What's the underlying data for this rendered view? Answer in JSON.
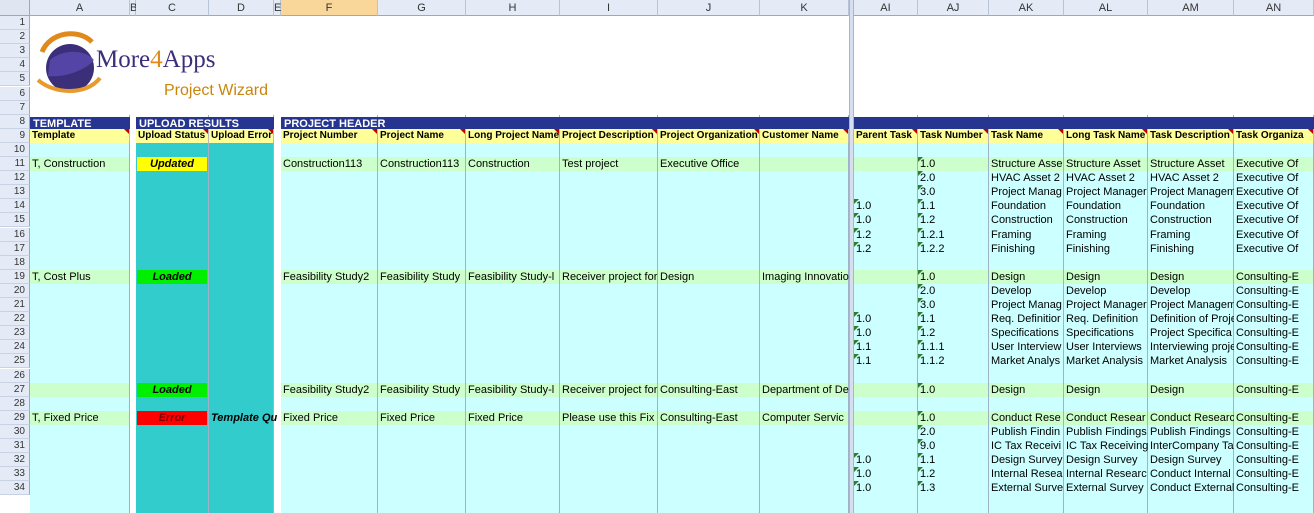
{
  "columns": [
    "A",
    "B",
    "C",
    "D",
    "E",
    "F",
    "G",
    "H",
    "I",
    "J",
    "K",
    "AI",
    "AJ",
    "AK",
    "AL",
    "AM",
    "AN"
  ],
  "row_numbers": [
    "1",
    "2",
    "3",
    "4",
    "5",
    "6",
    "7",
    "8",
    "9",
    "10",
    "11",
    "12",
    "13",
    "14",
    "15",
    "16",
    "17",
    "18",
    "19",
    "20",
    "21",
    "22",
    "23",
    "24",
    "25",
    "26",
    "27",
    "28",
    "29",
    "30",
    "31",
    "32",
    "33",
    "34"
  ],
  "logo": {
    "brand_prefix": "More",
    "brand_digit": "4",
    "brand_suffix": "Apps",
    "subtitle": "Project Wizard"
  },
  "sections": {
    "template": "TEMPLATE",
    "upload": "UPLOAD RESULTS",
    "project_header": "PROJECT HEADER"
  },
  "field_headers": {
    "template": "Template",
    "upload_status": "Upload Status",
    "upload_error": "Upload Error",
    "project_number": "Project Number",
    "project_name": "Project Name",
    "long_project_name": "Long Project Name",
    "project_description": "Project Description",
    "project_organization": "Project Organization",
    "customer_name": "Customer Name",
    "parent_task": "Parent Task",
    "task_number": "Task Number",
    "task_name": "Task Name",
    "long_task_name": "Long Task Name",
    "task_description": "Task Description",
    "task_organization": "Task Organiza"
  },
  "projects": [
    {
      "row": "11",
      "template": "T, Construction",
      "status": "Updated",
      "error": "",
      "number": "Construction113",
      "name": "Construction113",
      "long_name": "Construction",
      "description": "Test project",
      "organization": "Executive Office",
      "customer": ""
    },
    {
      "row": "19",
      "template": "T, Cost Plus",
      "status": "Loaded",
      "error": "",
      "number": "Feasibility Study2",
      "name": "Feasibility Study",
      "long_name": "Feasibility Study-l",
      "description": "Receiver project for",
      "organization": "Design",
      "customer": "Imaging Innovatio"
    },
    {
      "row": "27",
      "template": "",
      "status": "Loaded",
      "error": "",
      "number": "Feasibility Study2",
      "name": "Feasibility Study",
      "long_name": "Feasibility Study-l",
      "description": "Receiver project for",
      "organization": "Consulting-East",
      "customer": "Department of De"
    },
    {
      "row": "29",
      "template": "T, Fixed Price",
      "status": "Error",
      "error": "Template Qu",
      "number": "Fixed Price",
      "name": "Fixed Price",
      "long_name": "Fixed Price",
      "description": "Please use this Fix",
      "organization": "Consulting-East",
      "customer": "Computer Servic"
    }
  ],
  "tasks": [
    {
      "row": "11",
      "parent": "",
      "number": "1.0",
      "name": "Structure Asse",
      "long_name": "Structure Asset",
      "description": "Structure Asset",
      "organization": "Executive Of"
    },
    {
      "row": "12",
      "parent": "",
      "number": "2.0",
      "name": "HVAC Asset 2",
      "long_name": "HVAC Asset 2",
      "description": "HVAC Asset 2",
      "organization": "Executive Of"
    },
    {
      "row": "13",
      "parent": "",
      "number": "3.0",
      "name": "Project Manag",
      "long_name": "Project Manager",
      "description": "Project Managem",
      "organization": "Executive Of"
    },
    {
      "row": "14",
      "parent": "1.0",
      "number": "1.1",
      "name": "Foundation",
      "long_name": "Foundation",
      "description": "Foundation",
      "organization": "Executive Of"
    },
    {
      "row": "15",
      "parent": "1.0",
      "number": "1.2",
      "name": "Construction",
      "long_name": "Construction",
      "description": "Construction",
      "organization": "Executive Of"
    },
    {
      "row": "16",
      "parent": "1.2",
      "number": "1.2.1",
      "name": "Framing",
      "long_name": "Framing",
      "description": "Framing",
      "organization": "Executive Of"
    },
    {
      "row": "17",
      "parent": "1.2",
      "number": "1.2.2",
      "name": "Finishing",
      "long_name": "Finishing",
      "description": "Finishing",
      "organization": "Executive Of"
    },
    {
      "row": "19",
      "parent": "",
      "number": "1.0",
      "name": "Design",
      "long_name": "Design",
      "description": "Design",
      "organization": "Consulting-E"
    },
    {
      "row": "20",
      "parent": "",
      "number": "2.0",
      "name": "Develop",
      "long_name": "Develop",
      "description": "Develop",
      "organization": "Consulting-E"
    },
    {
      "row": "21",
      "parent": "",
      "number": "3.0",
      "name": "Project Manag",
      "long_name": "Project Manager",
      "description": "Project Managem",
      "organization": "Consulting-E"
    },
    {
      "row": "22",
      "parent": "1.0",
      "number": "1.1",
      "name": "Req. Definitior",
      "long_name": "Req. Definition",
      "description": "Definition of Proje",
      "organization": "Consulting-E"
    },
    {
      "row": "23",
      "parent": "1.0",
      "number": "1.2",
      "name": "Specifications",
      "long_name": "Specifications",
      "description": "Project Specifica",
      "organization": "Consulting-E"
    },
    {
      "row": "24",
      "parent": "1.1",
      "number": "1.1.1",
      "name": "User Interview",
      "long_name": "User Interviews",
      "description": "Interviewing proje",
      "organization": "Consulting-E"
    },
    {
      "row": "25",
      "parent": "1.1",
      "number": "1.1.2",
      "name": "Market Analys",
      "long_name": "Market Analysis",
      "description": "Market Analysis",
      "organization": "Consulting-E"
    },
    {
      "row": "27",
      "parent": "",
      "number": "1.0",
      "name": "Design",
      "long_name": "Design",
      "description": "Design",
      "organization": "Consulting-E"
    },
    {
      "row": "29",
      "parent": "",
      "number": "1.0",
      "name": "Conduct Rese",
      "long_name": "Conduct Resear",
      "description": "Conduct Researc",
      "organization": "Consulting-E"
    },
    {
      "row": "30",
      "parent": "",
      "number": "2.0",
      "name": "Publish Findin",
      "long_name": "Publish Findings",
      "description": "Publish Findings",
      "organization": "Consulting-E"
    },
    {
      "row": "31",
      "parent": "",
      "number": "9.0",
      "name": "IC Tax Receivi",
      "long_name": "IC Tax Receiving",
      "description": "InterCompany Ta",
      "organization": "Consulting-E"
    },
    {
      "row": "32",
      "parent": "1.0",
      "number": "1.1",
      "name": "Design Survey",
      "long_name": "Design Survey",
      "description": "Design Survey",
      "organization": "Consulting-E"
    },
    {
      "row": "33",
      "parent": "1.0",
      "number": "1.2",
      "name": "Internal Resea",
      "long_name": "Internal Researc",
      "description": "Conduct Internal",
      "organization": "Consulting-E"
    },
    {
      "row": "34",
      "parent": "1.0",
      "number": "1.3",
      "name": "External Surve",
      "long_name": "External Survey",
      "description": "Conduct External",
      "organization": "Consulting-E"
    }
  ],
  "colors": {
    "section_bar": "#26358f",
    "field_header": "#ffff99",
    "light_cyan": "#ccffff",
    "teal": "#33cccc",
    "row_band": "#ccffcc",
    "status_updated": "#ffff00",
    "status_loaded": "#00ee00",
    "status_error": "#ff0000"
  }
}
